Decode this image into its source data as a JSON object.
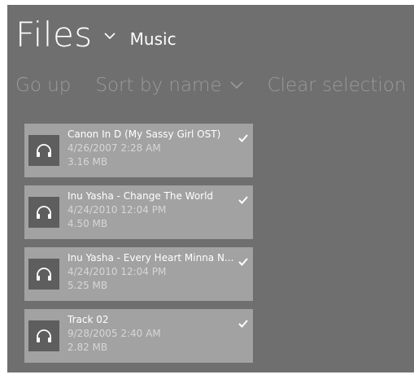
{
  "header": {
    "title": "Files",
    "folder": "Music"
  },
  "toolbar": {
    "go_up": "Go up",
    "sort_label": "Sort by name",
    "clear_selection": "Clear selection"
  },
  "files": [
    {
      "name": "Canon In D (My Sassy Girl OST)",
      "date": "4/26/2007 2:28 AM",
      "size": "3.16 MB",
      "selected": true,
      "icon": "headphones-icon"
    },
    {
      "name": "Inu Yasha - Change The World",
      "date": "4/24/2010 12:04 PM",
      "size": "4.50 MB",
      "selected": true,
      "icon": "headphones-icon"
    },
    {
      "name": "Inu Yasha - Every Heart Minna N...",
      "date": "4/24/2010 12:04 PM",
      "size": "5.25 MB",
      "selected": true,
      "icon": "headphones-icon"
    },
    {
      "name": "Track 02",
      "date": "9/28/2005 2:40 AM",
      "size": "2.82 MB",
      "selected": true,
      "icon": "headphones-icon"
    }
  ],
  "colors": {
    "background": "#6f6f6f",
    "tile": "#a2a2a2",
    "thumb": "#5e5e5e",
    "toolbar_text": "#9a9a9a"
  }
}
